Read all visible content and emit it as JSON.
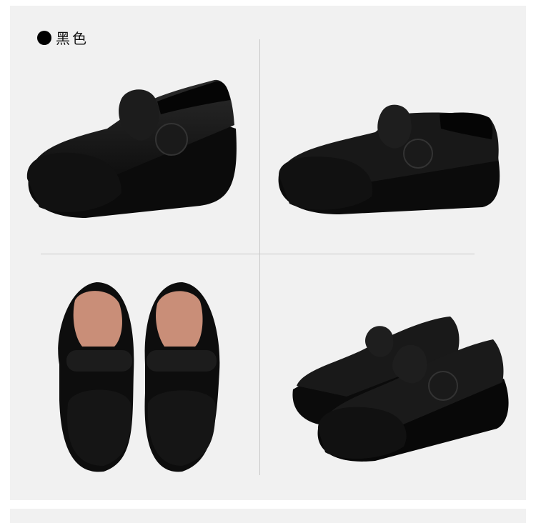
{
  "color_label": "黑色",
  "colors": {
    "panel": "#f1f1f1",
    "leather": "#141414",
    "sole": "#0c0c0c",
    "lining": "#c98e78",
    "divider": "#c9c9c9"
  },
  "views": [
    "side-left",
    "side-right",
    "top-pair",
    "angled-pair"
  ]
}
